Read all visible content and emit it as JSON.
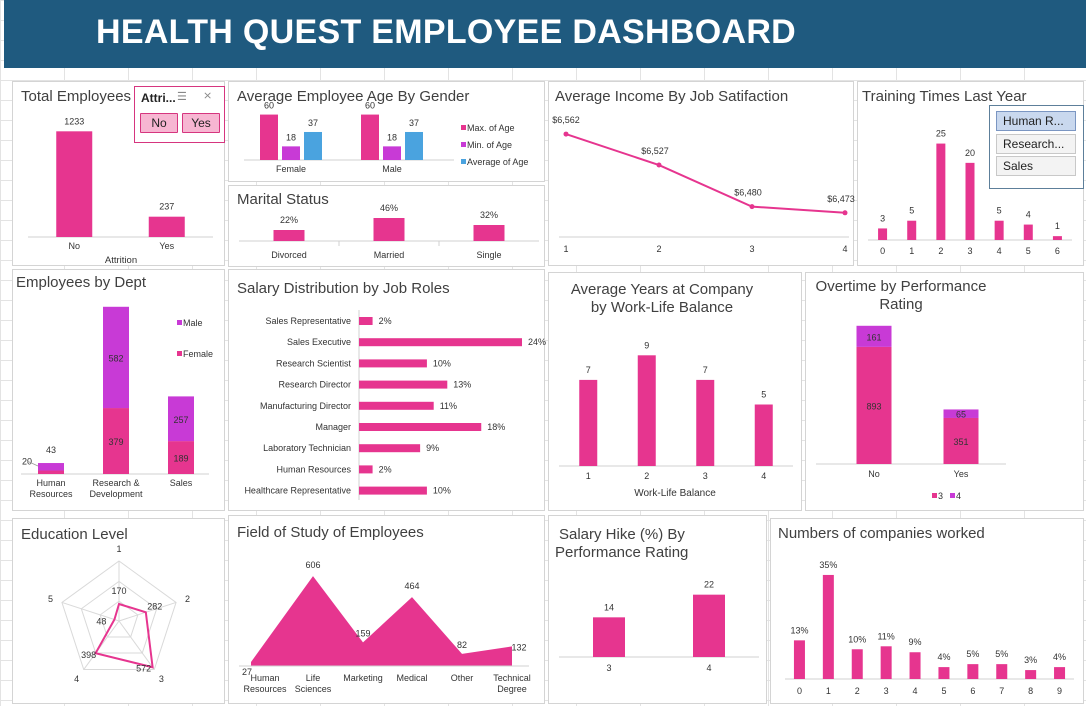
{
  "header": {
    "title": "HEALTH QUEST EMPLOYEE DASHBOARD"
  },
  "colors": {
    "pink": "#e6358f",
    "purple": "#c83ad6",
    "blue": "#4aa3df",
    "header": "#1f5a7f"
  },
  "attrition_slicer": {
    "title": "Attri...",
    "options": [
      "No",
      "Yes"
    ],
    "filter_icon": "multi-select-icon",
    "clear_icon": "clear-filter-icon"
  },
  "training_slicer": {
    "options": [
      "Human R...",
      "Research...",
      "Sales"
    ],
    "selected": "Human R..."
  },
  "chart_data": [
    {
      "id": "total_employees",
      "type": "bar",
      "title": "Total Employees",
      "categories": [
        "No",
        "Yes"
      ],
      "values": [
        1233,
        237
      ],
      "xlabel": "Attrition",
      "ylim": [
        0,
        1400
      ]
    },
    {
      "id": "age_by_gender",
      "type": "bar",
      "title": "Average Employee Age By Gender",
      "categories": [
        "Female",
        "Male"
      ],
      "series": [
        {
          "name": "Max. of Age",
          "values": [
            60,
            60
          ],
          "color": "#e6358f"
        },
        {
          "name": "Min. of Age",
          "values": [
            18,
            18
          ],
          "color": "#c83ad6"
        },
        {
          "name": "Average of Age",
          "values": [
            37,
            37
          ],
          "color": "#4aa3df"
        }
      ],
      "legend": "right",
      "ylim": [
        0,
        70
      ]
    },
    {
      "id": "marital_status",
      "type": "bar",
      "title": "Marital Status",
      "categories": [
        "Divorced",
        "Married",
        "Single"
      ],
      "values": [
        22,
        46,
        32
      ],
      "labels": [
        "22%",
        "46%",
        "32%"
      ],
      "ylim": [
        0,
        50
      ]
    },
    {
      "id": "income_by_satisfaction",
      "type": "line",
      "title": "Average Income By Job Satifaction",
      "categories": [
        "1",
        "2",
        "3",
        "4"
      ],
      "values": [
        6562,
        6527,
        6480,
        6473
      ],
      "labels": [
        "$6,562",
        "$6,527",
        "$6,480",
        "$6,473"
      ],
      "ylim": [
        6440,
        6570
      ]
    },
    {
      "id": "training_times",
      "type": "bar",
      "title": "Training Times Last Year",
      "categories": [
        "0",
        "1",
        "2",
        "3",
        "4",
        "5",
        "6"
      ],
      "values": [
        3,
        5,
        25,
        20,
        5,
        4,
        1
      ],
      "ylim": [
        0,
        28
      ]
    },
    {
      "id": "employees_by_dept",
      "type": "bar",
      "title": "Employees by Dept",
      "stacked": true,
      "categories": [
        "Human Resources",
        "Research & Development",
        "Sales"
      ],
      "category_lines": [
        [
          "Human",
          "Resources"
        ],
        [
          "Research &",
          "Development"
        ],
        [
          "Sales"
        ]
      ],
      "series": [
        {
          "name": "Female",
          "values": [
            20,
            379,
            189
          ],
          "color": "#e6358f"
        },
        {
          "name": "Male",
          "values": [
            43,
            582,
            257
          ],
          "color": "#c83ad6"
        }
      ],
      "legend": "right",
      "ylim": [
        0,
        1000
      ]
    },
    {
      "id": "salary_by_role",
      "type": "bar",
      "orientation": "horizontal",
      "title": "Salary Distribution by Job Roles",
      "categories": [
        "Sales Representative",
        "Sales Executive",
        "Research Scientist",
        "Research Director",
        "Manufacturing Director",
        "Manager",
        "Laboratory Technician",
        "Human Resources",
        "Healthcare Representative"
      ],
      "values": [
        2,
        24,
        10,
        13,
        11,
        18,
        9,
        2,
        10
      ],
      "labels": [
        "2%",
        "24%",
        "10%",
        "13%",
        "11%",
        "18%",
        "9%",
        "2%",
        "10%"
      ],
      "xlim": [
        0,
        24
      ]
    },
    {
      "id": "years_by_wlb",
      "type": "bar",
      "title": "Average Years at Company by Work-Life Balance",
      "title_lines": [
        "Average Years at Company",
        "by Work-Life Balance"
      ],
      "categories": [
        "1",
        "2",
        "3",
        "4"
      ],
      "values": [
        7,
        9,
        7,
        5
      ],
      "xlabel": "Work-Life Balance",
      "ylim": [
        0,
        10
      ]
    },
    {
      "id": "overtime_by_rating",
      "type": "bar",
      "stacked": true,
      "title": "Overtime by Performance Rating",
      "title_lines": [
        "Overtime by Performance",
        "Rating"
      ],
      "categories": [
        "No",
        "Yes"
      ],
      "series": [
        {
          "name": "3",
          "values": [
            893,
            351
          ],
          "color": "#e6358f"
        },
        {
          "name": "4",
          "values": [
            161,
            65
          ],
          "color": "#c83ad6"
        }
      ],
      "legend": "bottom",
      "ylim": [
        0,
        1060
      ]
    },
    {
      "id": "education_level",
      "type": "radar",
      "title": "Education Level",
      "categories": [
        "1",
        "2",
        "3",
        "4",
        "5"
      ],
      "values": [
        170,
        282,
        572,
        398,
        48
      ],
      "rmax": 600
    },
    {
      "id": "field_of_study",
      "type": "area",
      "title": "Field of Study of Employees",
      "categories": [
        "Human Resources",
        "Life Sciences",
        "Marketing",
        "Medical",
        "Other",
        "Technical Degree"
      ],
      "category_lines": [
        [
          "Human",
          "Resources"
        ],
        [
          "Life",
          "Sciences"
        ],
        [
          "Marketing"
        ],
        [
          "Medical"
        ],
        [
          "Other"
        ],
        [
          "Technical",
          "Degree"
        ]
      ],
      "values": [
        27,
        606,
        159,
        464,
        82,
        132
      ],
      "ylim": [
        0,
        620
      ]
    },
    {
      "id": "salary_hike",
      "type": "bar",
      "title": "Salary Hike (%) By Performance Rating",
      "title_lines": [
        "Salary Hike (%) By",
        "Performance Rating"
      ],
      "categories": [
        "3",
        "4"
      ],
      "values": [
        14,
        22
      ],
      "ylim": [
        0,
        24
      ]
    },
    {
      "id": "companies_worked",
      "type": "bar",
      "title": "Numbers of companies worked",
      "categories": [
        "0",
        "1",
        "2",
        "3",
        "4",
        "5",
        "6",
        "7",
        "8",
        "9"
      ],
      "values": [
        13,
        35,
        10,
        11,
        9,
        4,
        5,
        5,
        3,
        4
      ],
      "labels": [
        "13%",
        "35%",
        "10%",
        "11%",
        "9%",
        "4%",
        "5%",
        "5%",
        "3%",
        "4%"
      ],
      "ylim": [
        0,
        37
      ]
    }
  ]
}
